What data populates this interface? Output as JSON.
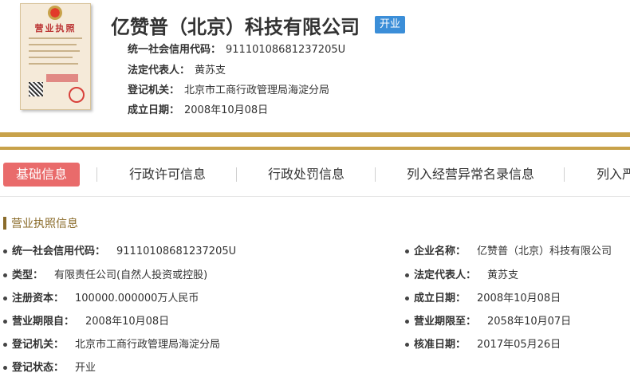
{
  "header": {
    "company_name": "亿赞普（北京）科技有限公司",
    "status": "开业",
    "license_title": "营业执照",
    "rows": [
      {
        "label": "统一社会信用代码：",
        "value": "91110108681237205U"
      },
      {
        "label": "法定代表人：",
        "value": "黄苏支"
      },
      {
        "label": "登记机关：",
        "value": "北京市工商行政管理局海淀分局"
      },
      {
        "label": "成立日期：",
        "value": "2008年10月08日"
      }
    ]
  },
  "nav": {
    "tabs": [
      "基础信息",
      "行政许可信息",
      "行政处罚信息",
      "列入经营异常名录信息",
      "列入严"
    ],
    "active": 0
  },
  "section": {
    "title": "营业执照信息",
    "left": [
      {
        "label": "统一社会信用代码：",
        "value": "91110108681237205U"
      },
      {
        "label": "类型：",
        "value": "有限责任公司(自然人投资或控股)"
      },
      {
        "label": "注册资本：",
        "value": "100000.000000万人民币"
      },
      {
        "label": "营业期限自：",
        "value": "2008年10月08日"
      },
      {
        "label": "登记机关：",
        "value": "北京市工商行政管理局海淀分局"
      },
      {
        "label": "登记状态：",
        "value": "开业"
      }
    ],
    "right": [
      {
        "label": "企业名称：",
        "value": "亿赞普（北京）科技有限公司"
      },
      {
        "label": "法定代表人：",
        "value": "黄苏支"
      },
      {
        "label": "成立日期：",
        "value": "2008年10月08日"
      },
      {
        "label": "营业期限至：",
        "value": "2058年10月07日"
      },
      {
        "label": "核准日期：",
        "value": "2017年05月26日"
      }
    ]
  },
  "colors": {
    "accent_gold": "#c8a24a",
    "tab_active": "#e96b6b",
    "badge_blue": "#3b8ed8",
    "section_brown": "#8a6b2a"
  }
}
